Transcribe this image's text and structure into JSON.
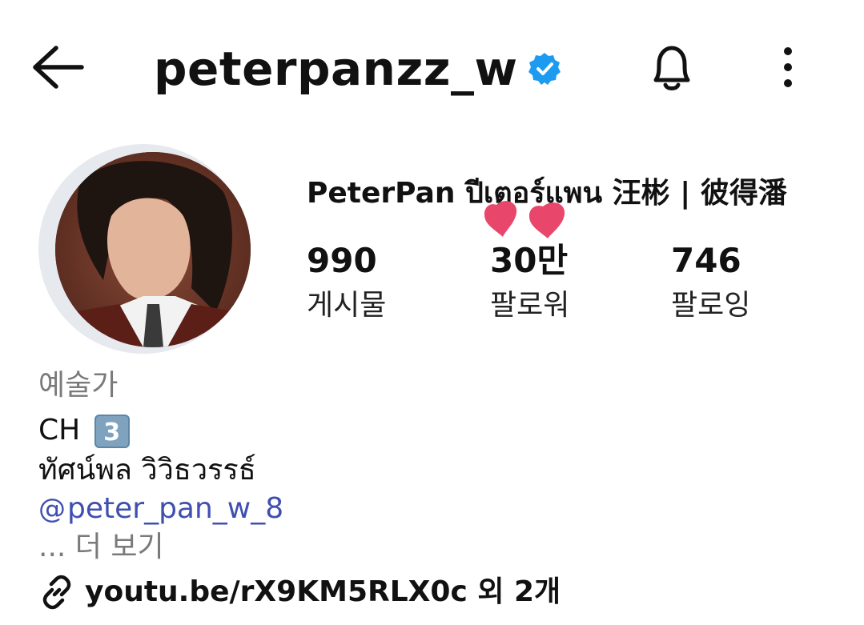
{
  "header": {
    "username": "peterpanzz_w",
    "back_icon": "back-arrow-icon",
    "verified_icon": "verified-badge-icon",
    "bell_icon": "bell-icon",
    "more_icon": "more-vertical-icon",
    "verified_color": "#1d9bf0"
  },
  "profile": {
    "full_name": "PeterPan ปีเตอร์แพน 汪彬 |  彼得潘",
    "stats": [
      {
        "value": "990",
        "label": "게시물"
      },
      {
        "value": "30만",
        "label": "팔로워"
      },
      {
        "value": "746",
        "label": "팔로잉"
      }
    ],
    "sticker": "heart-stickers"
  },
  "bio": {
    "category": "예술가",
    "line1": "CH",
    "keycap": "3",
    "line2": "ทัศน์พล วิวิธวรรธ์",
    "threads_handle": "peter_pan_w_8",
    "threads_glyph": "@",
    "more": "... 더 보기"
  },
  "links": {
    "text": "youtu.be/rX9KM5RLX0c 외 2개",
    "icon": "link-icon"
  },
  "colors": {
    "link_blue": "#3f4fb0",
    "muted_gray": "#7a7a7a",
    "heart_pink": "#e8466a"
  }
}
